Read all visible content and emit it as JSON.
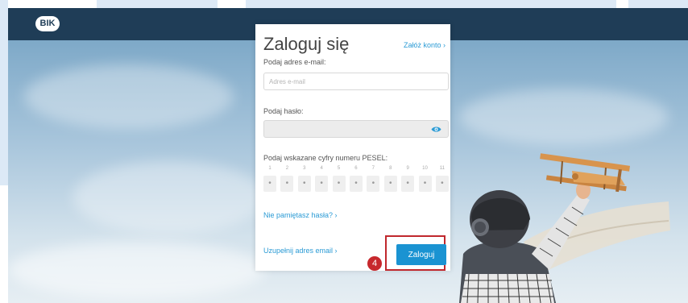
{
  "header": {
    "logo_text": "BIK"
  },
  "login": {
    "title": "Zaloguj się",
    "register_link": "Załóż konto ›",
    "email_label": "Podaj adres e-mail:",
    "email_placeholder": "Adres e-mail",
    "email_value": "",
    "password_label": "Podaj hasło:",
    "password_value": "",
    "pesel_label": "Podaj wskazane cyfry numeru PESEL:",
    "pesel_positions": [
      "1",
      "2",
      "3",
      "4",
      "5",
      "6",
      "7",
      "8",
      "9",
      "10",
      "11"
    ],
    "pesel_cell_glyph": "•",
    "forgot_link": "Nie pamiętasz hasła? ›",
    "login_button": "Zaloguj",
    "complete_email_link": "Uzupełnij adres email ›"
  },
  "annotation": {
    "step_number": "4",
    "highlight_color": "#c0282d"
  },
  "colors": {
    "header_bg": "#1f3d57",
    "link": "#2b9bd5",
    "button": "#1a93d2"
  },
  "icons": {
    "eye": "eye-icon",
    "logo": "bik-logo"
  }
}
